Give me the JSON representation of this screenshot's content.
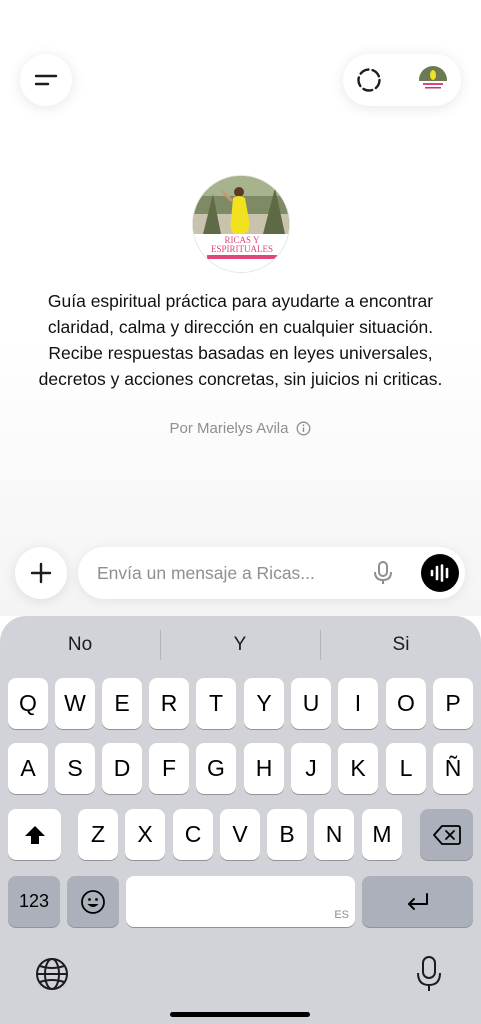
{
  "header": {
    "menu_icon": "menu-lines-icon",
    "new_chat_icon": "dashed-circle-icon"
  },
  "gpt": {
    "logo_line1": "RICAS Y",
    "logo_line2": "ESPIRITUALES",
    "description": "Guía espiritual práctica para ayudarte a encontrar claridad, calma y dirección en cualquier situación. Recibe respuestas basadas en leyes universales, decretos y acciones concretas, sin juicios ni criticas.",
    "author": "Por Marielys Avila",
    "colors": {
      "brand_pink": "#e0457b",
      "dress_yellow": "#f2e11f"
    }
  },
  "composer": {
    "placeholder": "Envía un mensaje a Ricas...",
    "value": "",
    "plus_icon": "plus-icon",
    "mic_icon": "microphone-icon",
    "voice_icon": "voice-waveform-icon"
  },
  "keyboard": {
    "suggestions": [
      "No",
      "Y",
      "Si"
    ],
    "row1": [
      "Q",
      "W",
      "E",
      "R",
      "T",
      "Y",
      "U",
      "I",
      "O",
      "P"
    ],
    "row2": [
      "A",
      "S",
      "D",
      "F",
      "G",
      "H",
      "J",
      "K",
      "L",
      "Ñ"
    ],
    "row3": [
      "Z",
      "X",
      "C",
      "V",
      "B",
      "N",
      "M"
    ],
    "numbers_label": "123",
    "space_lang": "ES",
    "shift_icon": "shift-arrow-icon",
    "delete_icon": "backspace-icon",
    "emoji_icon": "emoji-icon",
    "return_icon": "return-arrow-icon",
    "globe_icon": "globe-icon",
    "dictation_icon": "microphone-icon"
  }
}
